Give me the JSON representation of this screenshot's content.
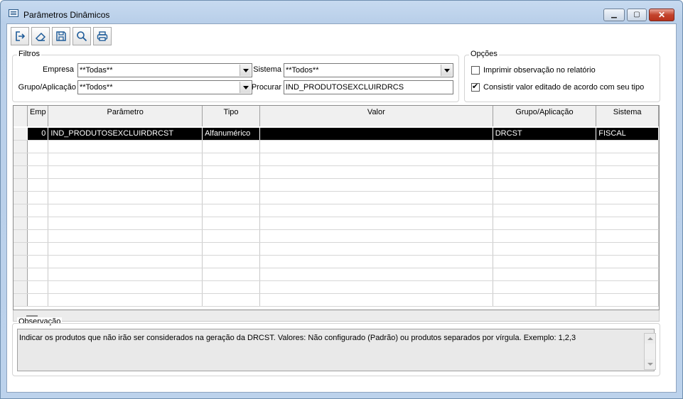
{
  "window": {
    "title": "Parâmetros Dinâmicos",
    "min_glyph": "▁",
    "max_glyph": "▢",
    "close_glyph": "✕"
  },
  "toolbar": {
    "buttons": [
      {
        "name": "exit-button",
        "icon": "exit-icon"
      },
      {
        "name": "clear-button",
        "icon": "eraser-icon"
      },
      {
        "name": "save-button",
        "icon": "save-icon"
      },
      {
        "name": "search-button",
        "icon": "search-icon"
      },
      {
        "name": "print-button",
        "icon": "print-icon"
      }
    ]
  },
  "filtros": {
    "label": "Filtros",
    "empresa_label": "Empresa",
    "empresa_value": "**Todas**",
    "sistema_label": "Sistema",
    "sistema_value": "**Todos**",
    "grupo_label": "Grupo/Aplicação",
    "grupo_value": "**Todos**",
    "procurar_label": "Procurar",
    "procurar_value": "IND_PRODUTOSEXCLUIRDRCS"
  },
  "opcoes": {
    "label": "Opções",
    "opt1_label": "Imprimir observação no relatório",
    "opt1_checked": false,
    "opt2_label": "Consistir valor editado de acordo com seu tipo",
    "opt2_checked": true
  },
  "grid": {
    "columns": [
      "Emp",
      "Parâmetro",
      "Tipo",
      "Valor",
      "Grupo/Aplicação",
      "Sistema"
    ],
    "rows": [
      {
        "emp": "0",
        "parametro": "IND_PRODUTOSEXCLUIRDRCST",
        "tipo": "Alfanumérico",
        "valor": "",
        "grupo": "DRCST",
        "sistema": "FISCAL"
      }
    ]
  },
  "observacao": {
    "label": "Observação",
    "text": "Indicar os produtos que não irão ser considerados na geração da DRCST. Valores: Não configurado (Padrão) ou produtos separados por vírgula. Exemplo: 1,2,3"
  }
}
